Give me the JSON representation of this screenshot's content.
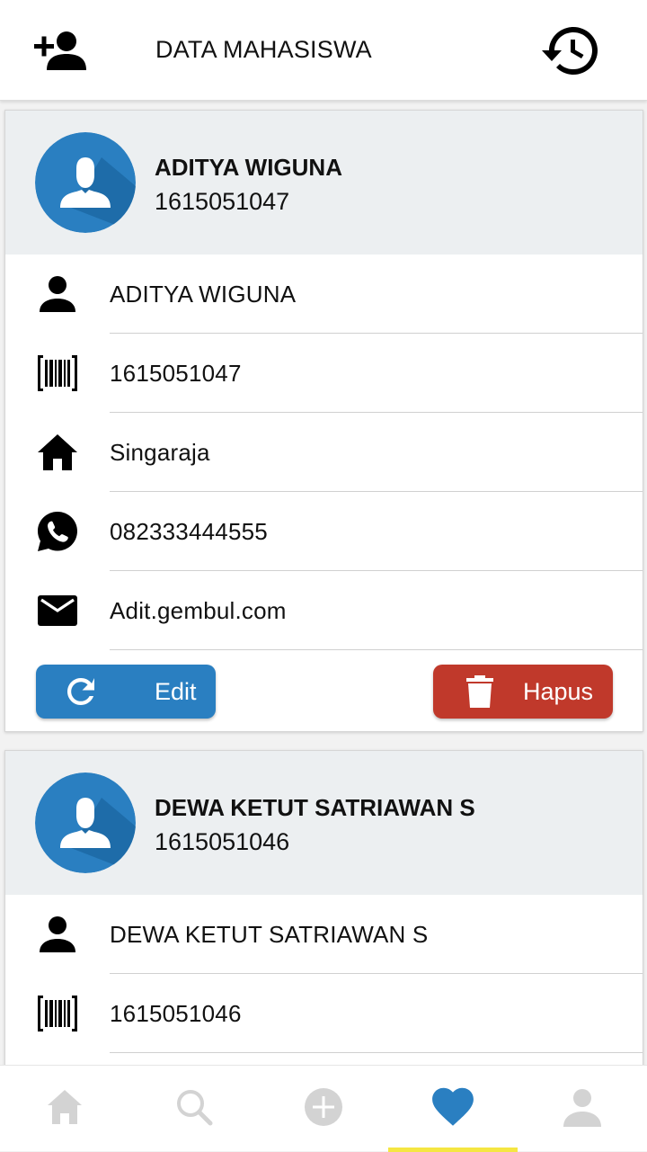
{
  "appbar": {
    "title": "DATA MAHASISWA",
    "left_icon": "add-user-icon",
    "right_icon": "history-icon"
  },
  "students": [
    {
      "name": "ADITYA WIGUNA",
      "nim": "1615051047",
      "fields": [
        {
          "icon": "person-icon",
          "value": "ADITYA WIGUNA"
        },
        {
          "icon": "barcode-icon",
          "value": "1615051047"
        },
        {
          "icon": "home-icon",
          "value": "Singaraja"
        },
        {
          "icon": "whatsapp-icon",
          "value": "082333444555"
        },
        {
          "icon": "mail-icon",
          "value": "Adit.gembul.com"
        }
      ],
      "edit_label": "Edit",
      "delete_label": "Hapus"
    },
    {
      "name": "DEWA KETUT SATRIAWAN S",
      "nim": "1615051046",
      "fields": [
        {
          "icon": "person-icon",
          "value": "DEWA KETUT SATRIAWAN S"
        },
        {
          "icon": "barcode-icon",
          "value": "1615051046"
        }
      ]
    }
  ],
  "bottom_nav": {
    "items": [
      "home-icon",
      "search-icon",
      "add-circle-icon",
      "heart-icon",
      "profile-icon"
    ],
    "active_index": 3
  },
  "colors": {
    "avatar_blue": "#2a7fc1",
    "edit_button": "#2a7fc1",
    "delete_button": "#c0392b",
    "active_nav": "#2a7fc1",
    "inactive_nav": "#d3d3d3",
    "nav_indicator": "#f5e642",
    "card_header_bg": "#eceff1"
  }
}
